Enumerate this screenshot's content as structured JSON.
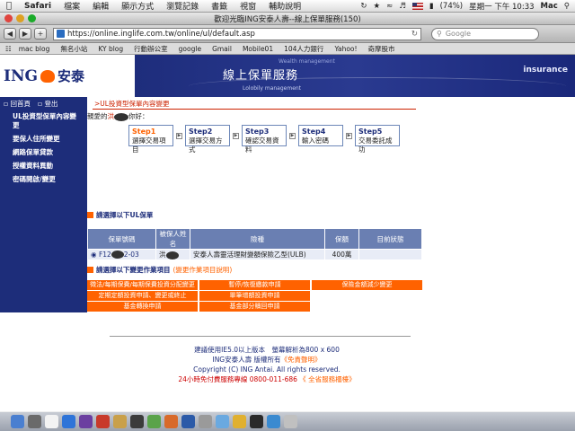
{
  "menubar": {
    "app": "Safari",
    "items": [
      "檔案",
      "編輯",
      "顯示方式",
      "瀏覽記錄",
      "書籤",
      "視窗",
      "輔助說明"
    ],
    "battery": "(74%)",
    "clock": "星期一 下午 10:33",
    "user": "Mac"
  },
  "window": {
    "title": "歡迎光臨ING安泰人壽--線上保單服務(150)",
    "url": "https://online.inglife.com.tw/online/ul/default.asp",
    "search_placeholder": "Google"
  },
  "bookmarks": [
    "mac blog",
    "無名小站",
    "KY blog",
    "行動辦公室",
    "google",
    "Gmail",
    "Mobile01",
    "104人力銀行",
    "Yahoo!",
    "奇摩股市"
  ],
  "banner": {
    "logo_text": "ING",
    "logo_cn": "安泰",
    "title": "線上保單服務",
    "insurance": "insurance",
    "sub": "Lolobily management",
    "sub2": "Wealth management"
  },
  "sidebar": {
    "home": "回首頁",
    "logout": "登出",
    "items": [
      "UL投資型保單內容變更",
      "要保人住所變更",
      "網路保單貸款",
      "授權資料異動",
      "密碼開啟/變更"
    ]
  },
  "main": {
    "breadcrumb": ">UL投資型保單內容變更",
    "greeting_prefix": "親愛的",
    "greeting_name": "洪",
    "greeting_suffix": "你好：",
    "steps": [
      {
        "num": "Step1",
        "label": "選擇交易項目"
      },
      {
        "num": "Step2",
        "label": "選擇交易方式"
      },
      {
        "num": "Step3",
        "label": "確認交易資料"
      },
      {
        "num": "Step4",
        "label": "輸入密碼"
      },
      {
        "num": "Step5",
        "label": "交易委託成功"
      }
    ],
    "section1_title": "請選擇以下UL保單",
    "table_headers": [
      "保單號碼",
      "被保人姓名",
      "險種",
      "保額",
      "目前狀態"
    ],
    "policy": {
      "number_start": "F12",
      "number_end": "2-03",
      "insured": "洪",
      "product": "安泰人壽靈活理財變額保險乙型(ULB)",
      "amount": "400萬",
      "status": ""
    },
    "section2_title": "請選擇以下變更作業項目",
    "section2_note": "(變更作業項目說明)",
    "change_items": [
      "徵法/每期保費/每期保費投資分配變更",
      "暫停/恢復繳款申請",
      "保險金額減少變更",
      "定期定額投資申請、變更或終止",
      "單筆增額投資申請",
      "",
      "基金轉換申請",
      "基金部分贖回申請",
      ""
    ]
  },
  "footer": {
    "line1": "建議使用IE5.0以上版本　螢幕解析為800 x 600",
    "line2a": "ING安泰人壽 版權所有",
    "line2b": "《免責聲明》",
    "line3": "Copyright (C) ING Antai. All rights reserved.",
    "line4a": "24小時免付費服務專線 0800-011-686",
    "line4b": "《 全省服務櫃檯》"
  },
  "colors": {
    "ing_blue": "#1d2d7a",
    "ing_orange": "#ff6200",
    "step_border": "#6d87b8"
  }
}
